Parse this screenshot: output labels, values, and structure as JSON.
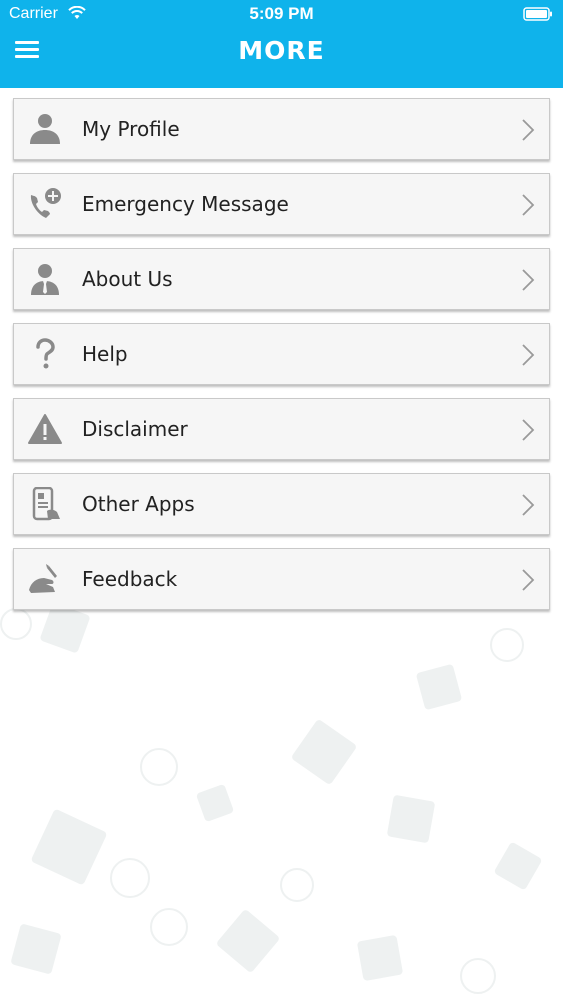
{
  "status_bar": {
    "carrier": "Carrier",
    "time": "5:09 PM"
  },
  "header": {
    "title": "MORE",
    "menu_icon": "hamburger-menu-icon",
    "background_color": "#0fb3eb"
  },
  "menu": {
    "items": [
      {
        "label": "My Profile",
        "icon": "user-icon"
      },
      {
        "label": "Emergency Message",
        "icon": "phone-plus-icon"
      },
      {
        "label": "About Us",
        "icon": "businessman-icon"
      },
      {
        "label": "Help",
        "icon": "question-mark-icon"
      },
      {
        "label": "Disclaimer",
        "icon": "warning-icon"
      },
      {
        "label": "Other Apps",
        "icon": "mobile-apps-icon"
      },
      {
        "label": "Feedback",
        "icon": "writing-hand-icon"
      }
    ],
    "chevron_icon": "chevron-right-icon",
    "icon_color": "#8a8a8a"
  }
}
